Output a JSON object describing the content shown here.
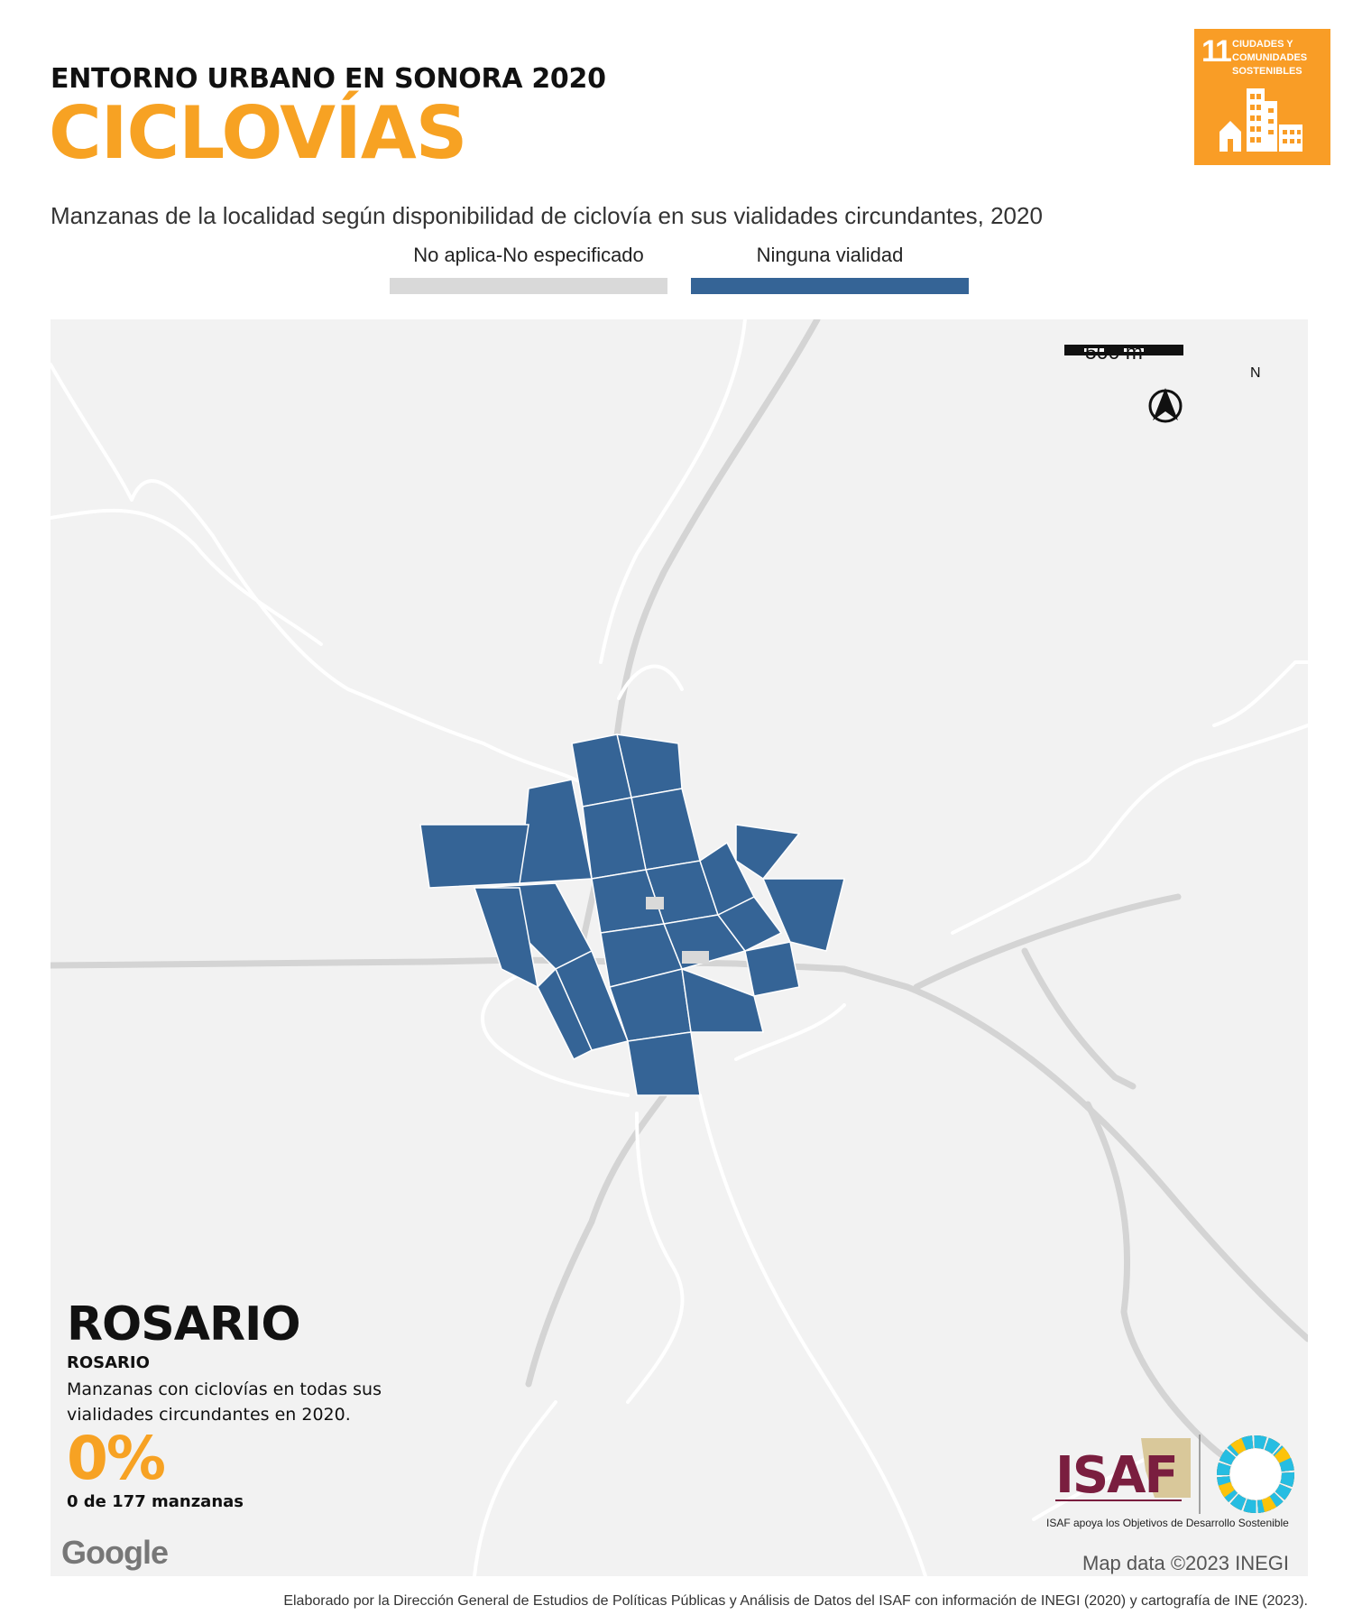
{
  "header": {
    "supertitle": "ENTORNO URBANO EN SONORA 2020",
    "title": "CICLOVÍAS",
    "subtitle": "Manzanas de la localidad según disponibilidad de ciclovía en sus vialidades circundantes, 2020"
  },
  "sdg_badge": {
    "number": "11",
    "text": "CIUDADES Y COMUNIDADES SOSTENIBLES",
    "color": "#F99D26"
  },
  "legend": [
    {
      "label": "No aplica-No especificado",
      "color": "#D9D9D9"
    },
    {
      "label": "Ninguna vialidad",
      "color": "#356496"
    }
  ],
  "map": {
    "background": "#F2F2F2",
    "block_color": "#356496",
    "scale_label": "500 m",
    "north_label": "N",
    "attribution": "Map data ©2023 INEGI",
    "provider_logo": "Google"
  },
  "locality": {
    "name": "ROSARIO",
    "municipality": "ROSARIO",
    "stat_description": "Manzanas con ciclovías en todas sus vialidades circundantes en 2020.",
    "percent": "0%",
    "count_text": "0 de 177 manzanas"
  },
  "isaf": {
    "name": "ISAF",
    "tagline": "ISAF apoya los Objetivos de Desarrollo Sostenible"
  },
  "footer": {
    "credit": "Elaborado por la Dirección General de Estudios de Políticas Públicas y Análisis de Datos del ISAF con información de INEGI (2020) y cartografía de INE (2023)."
  }
}
